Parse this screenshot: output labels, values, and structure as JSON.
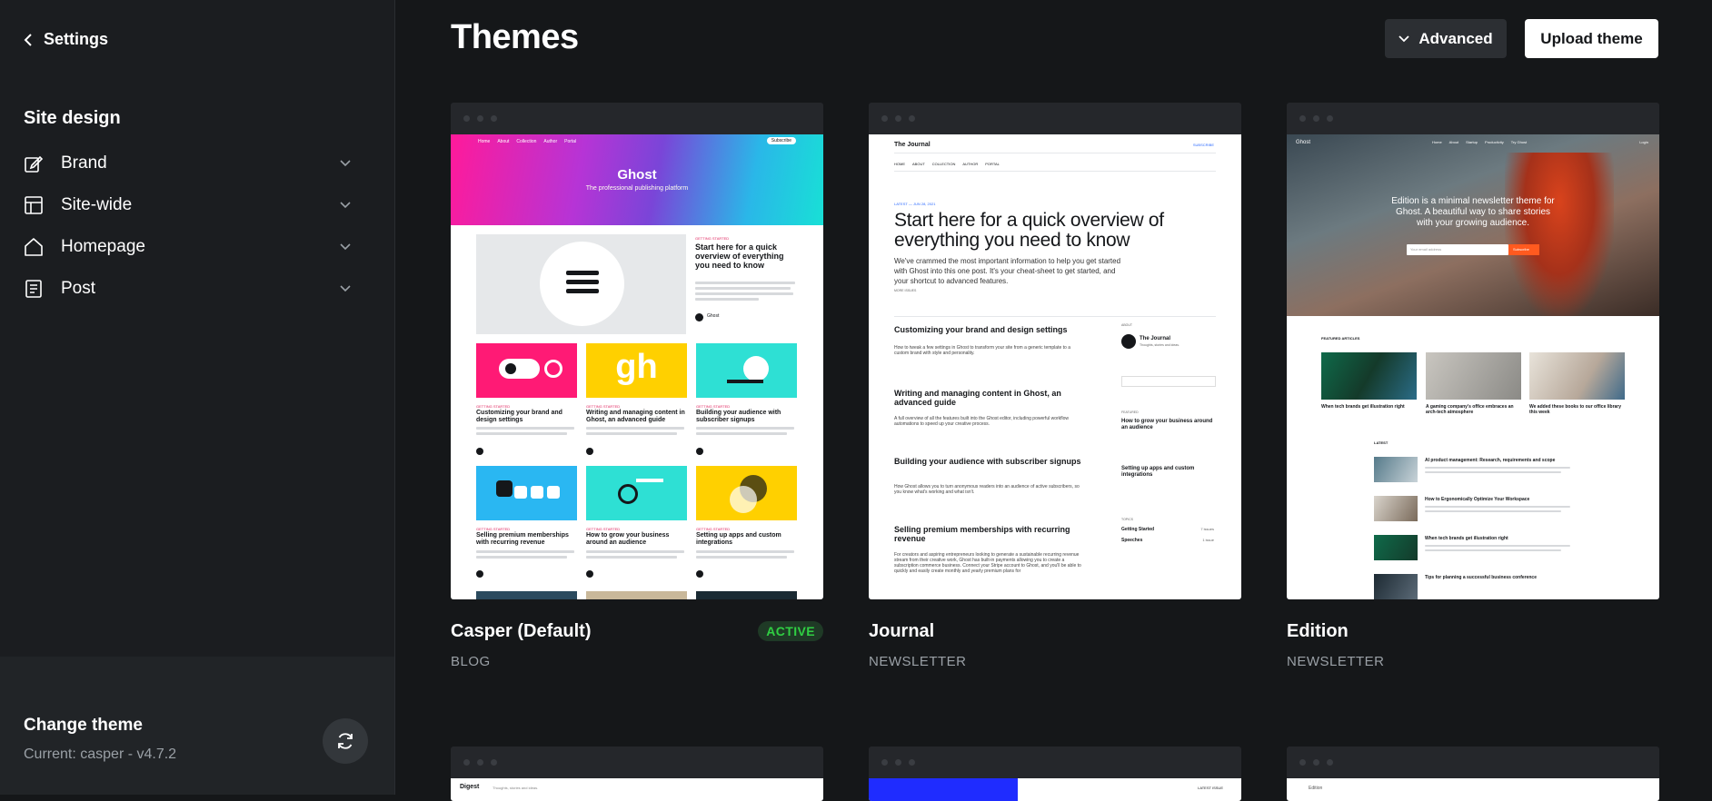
{
  "sidebar": {
    "back_label": "Settings",
    "section_title": "Site design",
    "items": [
      {
        "label": "Brand",
        "icon": "edit-icon"
      },
      {
        "label": "Site-wide",
        "icon": "layout-icon"
      },
      {
        "label": "Homepage",
        "icon": "home-icon"
      },
      {
        "label": "Post",
        "icon": "document-icon"
      }
    ],
    "footer": {
      "title": "Change theme",
      "current": "Current: casper - v4.7.2"
    }
  },
  "main": {
    "title": "Themes",
    "advanced_label": "Advanced",
    "upload_label": "Upload theme",
    "themes": [
      {
        "name": "Casper (Default)",
        "category": "BLOG",
        "badge": "ACTIVE"
      },
      {
        "name": "Journal",
        "category": "NEWSLETTER"
      },
      {
        "name": "Edition",
        "category": "NEWSLETTER"
      }
    ],
    "casper_preview": {
      "nav": [
        "Home",
        "About",
        "Collection",
        "Author",
        "Portal"
      ],
      "subscribe": "Subscribe",
      "brand": "Ghost",
      "tagline": "The professional publishing platform",
      "featured_tag": "GETTING STARTED",
      "featured_title": "Start here for a quick overview of everything you need to know",
      "author": "Ghost",
      "meta": "Jun 28, 2021 • 2 min read",
      "posts": [
        {
          "tag": "GETTING STARTED",
          "title": "Customizing your brand and design settings"
        },
        {
          "tag": "GETTING STARTED",
          "title": "Writing and managing content in Ghost, an advanced guide"
        },
        {
          "tag": "GETTING STARTED",
          "title": "Building your audience with subscriber signups"
        },
        {
          "tag": "GETTING STARTED",
          "title": "Selling premium memberships with recurring revenue"
        },
        {
          "tag": "GETTING STARTED",
          "title": "How to grow your business around an audience"
        },
        {
          "tag": "GETTING STARTED",
          "title": "Setting up apps and custom integrations"
        }
      ],
      "gh_text": "gh"
    },
    "journal_preview": {
      "brand": "The Journal",
      "subscribe": "SUBSCRIBE",
      "nav": [
        "HOME",
        "ABOUT",
        "COLLECTION",
        "AUTHOR",
        "PORTAL"
      ],
      "latest": "LATEST — JUN 28, 2021",
      "hero_title": "Start here for a quick overview of everything you need to know",
      "hero_text": "We've crammed the most important information to help you get started with Ghost into this one post. It's your cheat-sheet to get started, and your shortcut to advanced features.",
      "more_issues": "MORE ISSUES",
      "about": "ABOUT",
      "featured": "FEATURED",
      "topics": "TOPICS",
      "posts": [
        {
          "title": "Customizing your brand and design settings",
          "text": "How to tweak a few settings in Ghost to transform your site from a generic template to a custom brand with style and personality."
        },
        {
          "title": "Writing and managing content in Ghost, an advanced guide",
          "text": "A full overview of all the features built into the Ghost editor, including powerful workflow automations to speed up your creative process."
        },
        {
          "title": "Building your audience with subscriber signups",
          "text": "How Ghost allows you to turn anonymous readers into an audience of active subscribers, so you know what's working and what isn't."
        },
        {
          "title": "Selling premium memberships with recurring revenue",
          "text": "For creators and aspiring entrepreneurs looking to generate a sustainable recurring revenue stream from their creative work, Ghost has built-in payments allowing you to create a subscription commerce business. Connect your Stripe account to Ghost, and you'll be able to quickly and easily create monthly and yearly premium plans for"
        }
      ],
      "side_brand": "The Journal",
      "side_tagline": "Thoughts, stories and ideas.",
      "side_featured": [
        "How to grow your business around an audience",
        "Setting up apps and custom integrations"
      ],
      "topics_list": [
        {
          "name": "Getting Started",
          "count": "7 issues"
        },
        {
          "name": "Speeches",
          "count": "1 issue"
        }
      ]
    },
    "edition_preview": {
      "brand": "Ghost",
      "nav": [
        "Home",
        "About",
        "Startup",
        "Productivity",
        "Try Ghost"
      ],
      "login": "Login",
      "hero_text": "Edition is a minimal newsletter theme for Ghost. A beautiful way to share stories with your growing audience.",
      "email_placeholder": "Your email address",
      "subscribe": "Subscribe",
      "featured_label": "FEATURED ARTICLES",
      "featured": [
        "When tech brands get illustration right",
        "A gaming company's office embraces an arch-tech atmosphere",
        "We added these books to our office library this week"
      ],
      "latest_label": "LATEST",
      "latest": [
        "AI product management: Research, requirements and scope",
        "How to Ergonomically Optimize Your Workspace",
        "When tech brands get illustration right",
        "Tips for planning a successful business conference"
      ]
    },
    "row2": {
      "digest_brand": "Digest",
      "digest_tagline": "Thoughts, stories and ideas.",
      "dawn_nav": "LATEST ISSUE",
      "third_brand": "Edition"
    }
  }
}
